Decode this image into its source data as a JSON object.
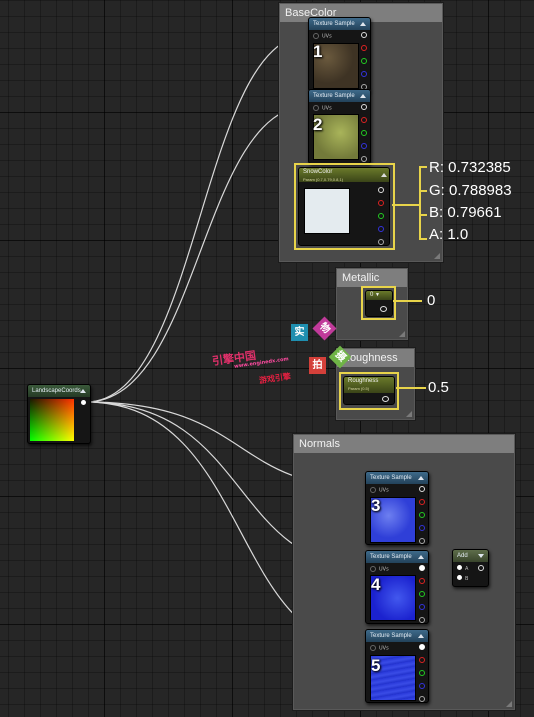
{
  "comments": {
    "basecolor": "BaseColor",
    "metallic": "Metallic",
    "roughness": "Roughness",
    "normals": "Normals"
  },
  "nodes": {
    "landscape_coords": "LandscapeCoords",
    "texture_sample_title": "Texture Sample",
    "uvs_label": "UVs",
    "snow_color_title": "SnowColor",
    "snow_color_sub": "Param (0.7,0.79,0.8,1)",
    "metallic_param_value": "0",
    "roughness_title": "Roughness",
    "roughness_sub": "Param (0.5)",
    "add_title": "Add",
    "add_a": "A",
    "add_b": "B"
  },
  "numbers": [
    "1",
    "2",
    "3",
    "4",
    "5"
  ],
  "callouts": {
    "r": "R: 0.732385",
    "g": "G: 0.788983",
    "b": "B: 0.79661",
    "a": "A: 1.0",
    "metallic": "0",
    "roughness": "0.5"
  },
  "watermark": {
    "line1": "引擎中国",
    "line2": "www.enginedx.com",
    "line3": "游戏引擎",
    "c1": "实",
    "c2": "物",
    "c3": "拍",
    "c4": "摄"
  },
  "colors": {
    "highlight": "#e8d44a",
    "snow": "#e4ebef",
    "normal": "#2f3fd8"
  }
}
